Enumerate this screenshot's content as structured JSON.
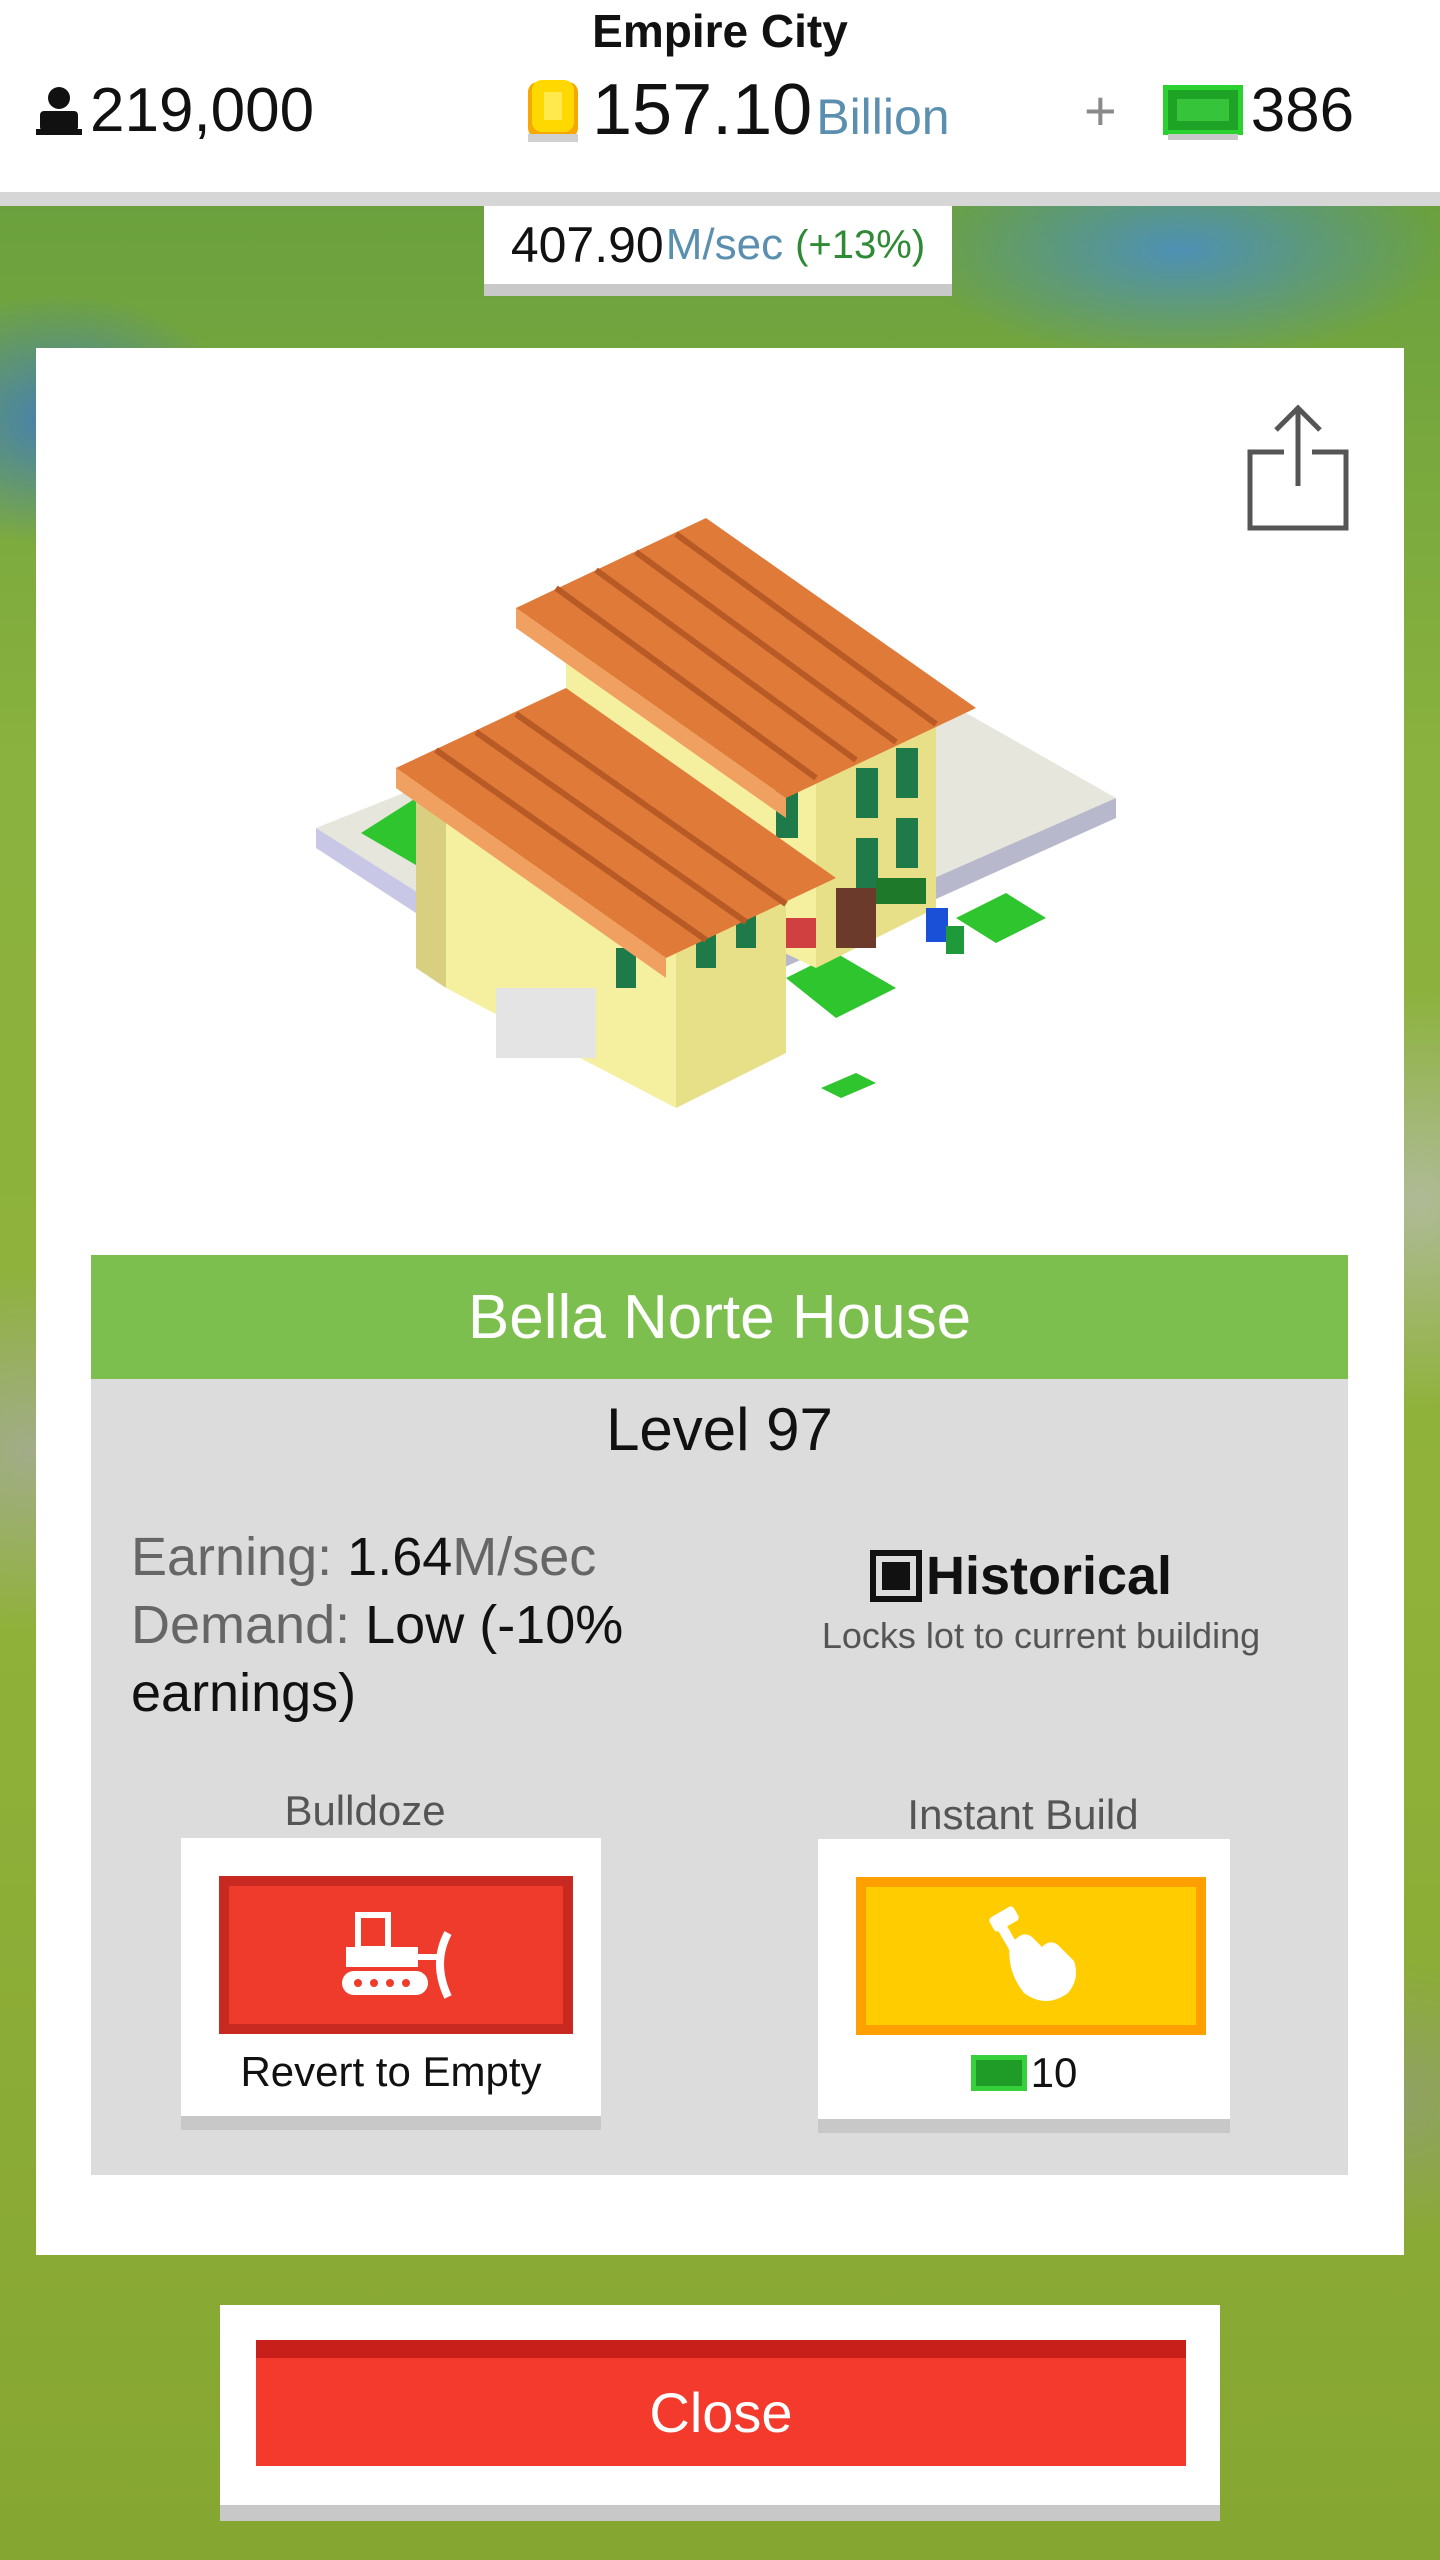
{
  "header": {
    "city_name": "Empire City",
    "population": "219,000",
    "coins_value": "157.10",
    "coins_unit": "Billion",
    "add_label": "+",
    "cash": "386",
    "income_value": "407.90",
    "income_unit": "M/sec",
    "income_pct": "(+13%)"
  },
  "building": {
    "name": "Bella Norte House",
    "level": "Level 97",
    "earning_label": "Earning:",
    "earning_value": "1.64",
    "earning_unit": "M/sec",
    "demand_label": "Demand:",
    "demand_value_line1": "Low (-10%",
    "demand_value_line2": "earnings)",
    "historical_label": "Historical",
    "historical_checked": true,
    "historical_desc": "Locks lot to current building"
  },
  "actions": {
    "bulldoze_title": "Bulldoze",
    "bulldoze_caption": "Revert to Empty",
    "instant_build_title": "Instant Build",
    "instant_build_cost": "10"
  },
  "close_label": "Close",
  "icons": {
    "population": "person-icon",
    "coins": "coin-icon",
    "cash": "cash-icon",
    "share": "share-icon",
    "bulldoze": "bulldozer-icon",
    "instant_build": "hammer-hand-icon"
  },
  "colors": {
    "name_bar": "#7dbf4e",
    "bulldoze": "#ef3b2c",
    "instant_build": "#ffcc00",
    "close": "#f33a2c",
    "cash_green": "#35c43a",
    "unit_blue": "#5b8fb0"
  }
}
